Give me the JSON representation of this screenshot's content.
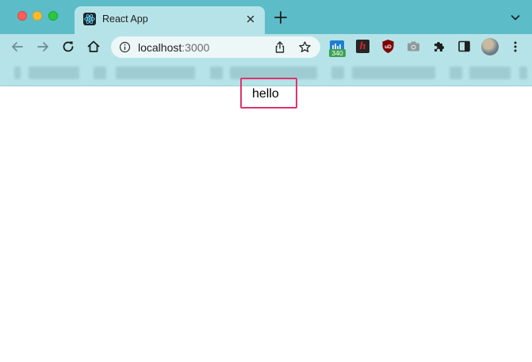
{
  "browser": {
    "tab": {
      "title": "React App"
    },
    "address_bar": {
      "host": "localhost",
      "port": ":3000"
    },
    "extensions": {
      "badge_count": "340",
      "h_label": "h",
      "ublock_label": "uD"
    },
    "colors": {
      "titlebar": "#5cbcc8",
      "toolbar": "#b6e3e8",
      "highlight": "#e0336b"
    }
  },
  "page": {
    "content_text": "hello"
  }
}
